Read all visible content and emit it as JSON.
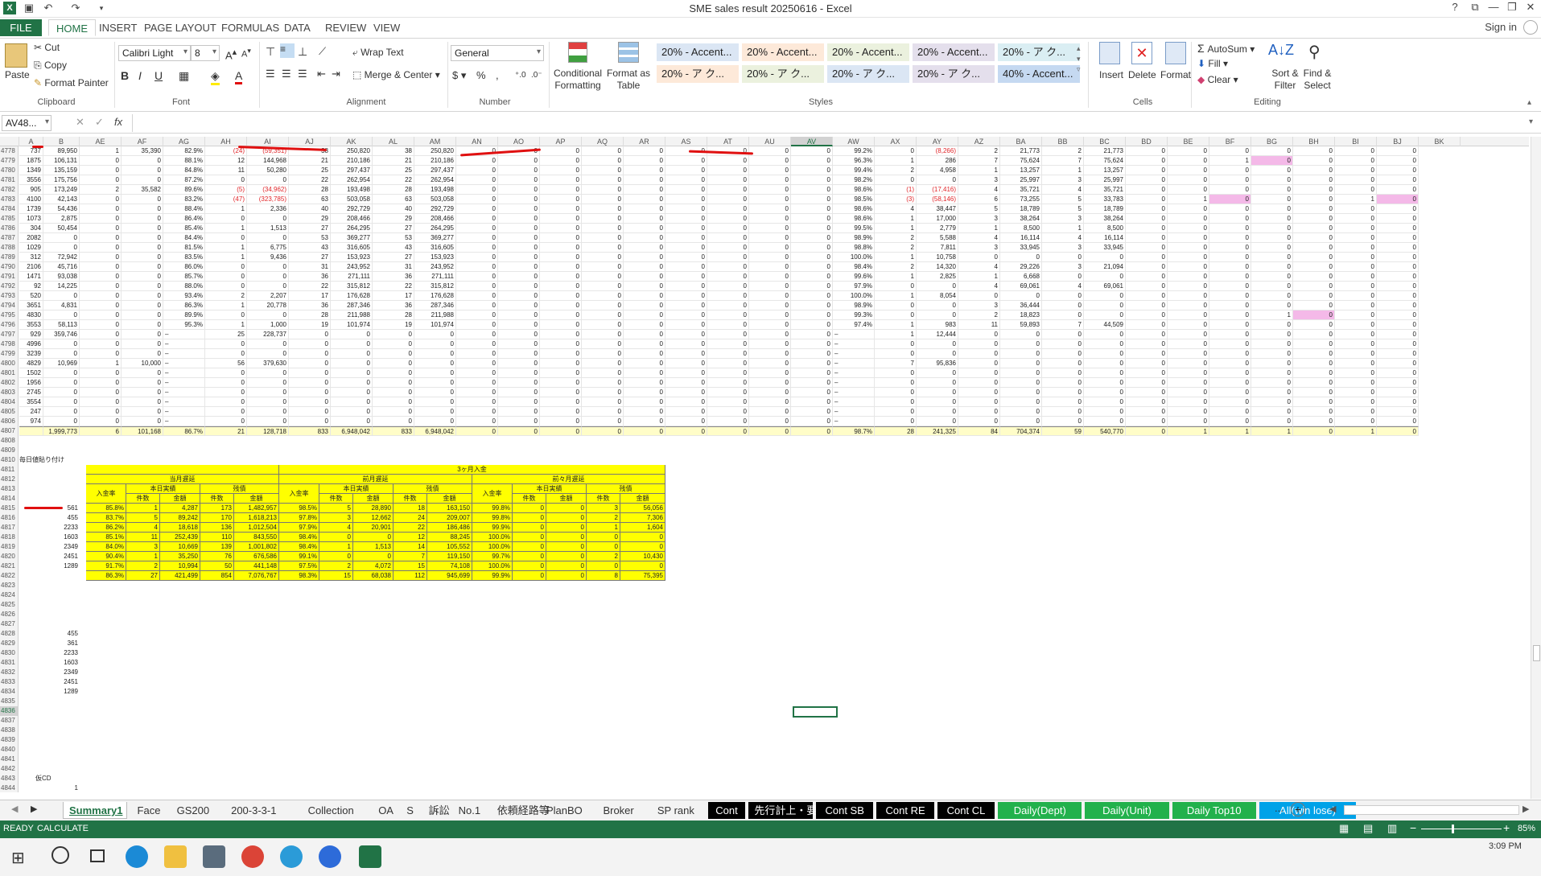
{
  "window": {
    "title": "SME sales result 20250616 - Excel",
    "signin": "Sign in",
    "help": "?"
  },
  "ribbon_tabs": [
    "FILE",
    "HOME",
    "INSERT",
    "PAGE LAYOUT",
    "FORMULAS",
    "DATA",
    "REVIEW",
    "VIEW"
  ],
  "clipboard": {
    "paste": "Paste",
    "cut": "Cut",
    "copy": "Copy",
    "format_painter": "Format Painter",
    "label": "Clipboard"
  },
  "font": {
    "name": "Calibri Light",
    "size": "8",
    "label": "Font"
  },
  "alignment": {
    "wrap": "Wrap Text",
    "merge": "Merge & Center",
    "label": "Alignment"
  },
  "number": {
    "format": "General",
    "label": "Number",
    "pct": "%",
    "comma": ","
  },
  "styles": {
    "conditional": "Conditional Formatting",
    "format_table": "Format as Table",
    "label": "Styles",
    "cells": [
      [
        "20% - Accent...",
        "20% - Accent...",
        "20% - Accent...",
        "20% - Accent...",
        "20% - ア ク..."
      ],
      [
        "20% - ア ク...",
        "20% - ア ク...",
        "20% - ア ク...",
        "20% - ア ク...",
        "40% - Accent..."
      ]
    ],
    "colors": [
      [
        "#dbe6f4",
        "#fde9d9",
        "#ebf1de",
        "#e4dfec",
        "#daeef3"
      ],
      [
        "#fde9d9",
        "#ebf1de",
        "#dbe6f4",
        "#e4dfec",
        "#c5d9f1"
      ]
    ]
  },
  "cells_grp": {
    "insert": "Insert",
    "delete": "Delete",
    "format": "Format",
    "label": "Cells"
  },
  "editing": {
    "autosum": "AutoSum",
    "fill": "Fill",
    "clear": "Clear",
    "sort": "Sort & Filter",
    "find": "Find & Select",
    "label": "Editing"
  },
  "formula_bar": {
    "name_box": "AV48...",
    "fx": "fx",
    "value": ""
  },
  "columns": [
    "A",
    "B",
    "AE",
    "AF",
    "AG",
    "AH",
    "AI",
    "AJ",
    "AK",
    "AL",
    "AM",
    "AN",
    "AO",
    "AP",
    "AQ",
    "AR",
    "AS",
    "AT",
    "AU",
    "AV",
    "AW",
    "AX",
    "AY",
    "AZ",
    "BA",
    "BB",
    "BC",
    "BD",
    "BE",
    "BF",
    "BG",
    "BH",
    "BI",
    "BJ",
    "BK"
  ],
  "rows": [
    [
      "4778",
      "737",
      "89,950",
      "1",
      "35,390",
      "82.9%",
      "(24)",
      "(59,351)",
      "38",
      "250,820",
      "38",
      "250,820",
      "0",
      "0",
      "0",
      "0",
      "0",
      "0",
      "0",
      "0",
      "0",
      "99.2%",
      "0",
      "(8,266)",
      "2",
      "21,773",
      "2",
      "21,773",
      "0",
      "0",
      "0",
      "0",
      "0",
      "0",
      "0"
    ],
    [
      "4779",
      "1875",
      "106,131",
      "0",
      "0",
      "88.1%",
      "12",
      "144,968",
      "21",
      "210,186",
      "21",
      "210,186",
      "0",
      "0",
      "0",
      "0",
      "0",
      "0",
      "0",
      "0",
      "0",
      "96.3%",
      "1",
      "286",
      "7",
      "75,624",
      "7",
      "75,624",
      "0",
      "0",
      "1",
      "0",
      "0",
      "0",
      "0"
    ],
    [
      "4780",
      "1349",
      "135,159",
      "0",
      "0",
      "84.8%",
      "11",
      "50,280",
      "25",
      "297,437",
      "25",
      "297,437",
      "0",
      "0",
      "0",
      "0",
      "0",
      "0",
      "0",
      "0",
      "0",
      "99.4%",
      "2",
      "4,958",
      "1",
      "13,257",
      "1",
      "13,257",
      "0",
      "0",
      "0",
      "0",
      "0",
      "0",
      "0"
    ],
    [
      "4781",
      "3556",
      "175,756",
      "0",
      "0",
      "87.2%",
      "0",
      "0",
      "22",
      "262,954",
      "22",
      "262,954",
      "0",
      "0",
      "0",
      "0",
      "0",
      "0",
      "0",
      "0",
      "0",
      "98.2%",
      "0",
      "0",
      "3",
      "25,997",
      "3",
      "25,997",
      "0",
      "0",
      "0",
      "0",
      "0",
      "0",
      "0"
    ],
    [
      "4782",
      "905",
      "173,249",
      "2",
      "35,582",
      "89.6%",
      "(5)",
      "(34,962)",
      "28",
      "193,498",
      "28",
      "193,498",
      "0",
      "0",
      "0",
      "0",
      "0",
      "0",
      "0",
      "0",
      "0",
      "98.6%",
      "(1)",
      "(17,416)",
      "4",
      "35,721",
      "4",
      "35,721",
      "0",
      "0",
      "0",
      "0",
      "0",
      "0",
      "0"
    ],
    [
      "4783",
      "4100",
      "42,143",
      "0",
      "0",
      "83.2%",
      "(47)",
      "(323,785)",
      "63",
      "503,058",
      "63",
      "503,058",
      "0",
      "0",
      "0",
      "0",
      "0",
      "0",
      "0",
      "0",
      "0",
      "98.5%",
      "(3)",
      "(58,146)",
      "6",
      "73,255",
      "5",
      "33,783",
      "0",
      "1",
      "0",
      "0",
      "0",
      "1",
      "0"
    ],
    [
      "4784",
      "1739",
      "54,436",
      "0",
      "0",
      "88.4%",
      "1",
      "2,336",
      "40",
      "292,729",
      "40",
      "292,729",
      "0",
      "0",
      "0",
      "0",
      "0",
      "0",
      "0",
      "0",
      "0",
      "98.6%",
      "4",
      "38,447",
      "5",
      "18,789",
      "5",
      "18,789",
      "0",
      "0",
      "0",
      "0",
      "0",
      "0",
      "0"
    ],
    [
      "4785",
      "1073",
      "2,875",
      "0",
      "0",
      "86.4%",
      "0",
      "0",
      "29",
      "208,466",
      "29",
      "208,466",
      "0",
      "0",
      "0",
      "0",
      "0",
      "0",
      "0",
      "0",
      "0",
      "98.6%",
      "1",
      "17,000",
      "3",
      "38,264",
      "3",
      "38,264",
      "0",
      "0",
      "0",
      "0",
      "0",
      "0",
      "0"
    ],
    [
      "4786",
      "304",
      "50,454",
      "0",
      "0",
      "85.4%",
      "1",
      "1,513",
      "27",
      "264,295",
      "27",
      "264,295",
      "0",
      "0",
      "0",
      "0",
      "0",
      "0",
      "0",
      "0",
      "0",
      "99.5%",
      "1",
      "2,779",
      "1",
      "8,500",
      "1",
      "8,500",
      "0",
      "0",
      "0",
      "0",
      "0",
      "0",
      "0"
    ],
    [
      "4787",
      "2082",
      "0",
      "0",
      "0",
      "84.4%",
      "0",
      "0",
      "53",
      "369,277",
      "53",
      "369,277",
      "0",
      "0",
      "0",
      "0",
      "0",
      "0",
      "0",
      "0",
      "0",
      "98.9%",
      "2",
      "5,588",
      "4",
      "16,114",
      "4",
      "16,114",
      "0",
      "0",
      "0",
      "0",
      "0",
      "0",
      "0"
    ],
    [
      "4788",
      "1029",
      "0",
      "0",
      "0",
      "81.5%",
      "1",
      "6,775",
      "43",
      "316,605",
      "43",
      "316,605",
      "0",
      "0",
      "0",
      "0",
      "0",
      "0",
      "0",
      "0",
      "0",
      "98.8%",
      "2",
      "7,811",
      "3",
      "33,945",
      "3",
      "33,945",
      "0",
      "0",
      "0",
      "0",
      "0",
      "0",
      "0"
    ],
    [
      "4789",
      "312",
      "72,942",
      "0",
      "0",
      "83.5%",
      "1",
      "9,436",
      "27",
      "153,923",
      "27",
      "153,923",
      "0",
      "0",
      "0",
      "0",
      "0",
      "0",
      "0",
      "0",
      "0",
      "100.0%",
      "1",
      "10,758",
      "0",
      "0",
      "0",
      "0",
      "0",
      "0",
      "0",
      "0",
      "0",
      "0",
      "0"
    ],
    [
      "4790",
      "2106",
      "45,716",
      "0",
      "0",
      "86.0%",
      "0",
      "0",
      "31",
      "243,952",
      "31",
      "243,952",
      "0",
      "0",
      "0",
      "0",
      "0",
      "0",
      "0",
      "0",
      "0",
      "98.4%",
      "2",
      "14,320",
      "4",
      "29,226",
      "3",
      "21,094",
      "0",
      "0",
      "0",
      "0",
      "0",
      "0",
      "0"
    ],
    [
      "4791",
      "1471",
      "93,038",
      "0",
      "0",
      "85.7%",
      "0",
      "0",
      "36",
      "271,111",
      "36",
      "271,111",
      "0",
      "0",
      "0",
      "0",
      "0",
      "0",
      "0",
      "0",
      "0",
      "99.6%",
      "1",
      "2,825",
      "1",
      "6,668",
      "0",
      "0",
      "0",
      "0",
      "0",
      "0",
      "0",
      "0",
      "0"
    ],
    [
      "4792",
      "92",
      "14,225",
      "0",
      "0",
      "88.0%",
      "0",
      "0",
      "22",
      "315,812",
      "22",
      "315,812",
      "0",
      "0",
      "0",
      "0",
      "0",
      "0",
      "0",
      "0",
      "0",
      "97.9%",
      "0",
      "0",
      "4",
      "69,061",
      "4",
      "69,061",
      "0",
      "0",
      "0",
      "0",
      "0",
      "0",
      "0"
    ],
    [
      "4793",
      "520",
      "0",
      "0",
      "0",
      "93.4%",
      "2",
      "2,207",
      "17",
      "176,628",
      "17",
      "176,628",
      "0",
      "0",
      "0",
      "0",
      "0",
      "0",
      "0",
      "0",
      "0",
      "100.0%",
      "1",
      "8,054",
      "0",
      "0",
      "0",
      "0",
      "0",
      "0",
      "0",
      "0",
      "0",
      "0",
      "0"
    ],
    [
      "4794",
      "3651",
      "4,831",
      "0",
      "0",
      "86.3%",
      "1",
      "20,778",
      "36",
      "287,346",
      "36",
      "287,346",
      "0",
      "0",
      "0",
      "0",
      "0",
      "0",
      "0",
      "0",
      "0",
      "98.9%",
      "0",
      "0",
      "3",
      "36,444",
      "0",
      "0",
      "0",
      "0",
      "0",
      "0",
      "0",
      "0",
      "0"
    ],
    [
      "4795",
      "4830",
      "0",
      "0",
      "0",
      "89.9%",
      "0",
      "0",
      "28",
      "211,988",
      "28",
      "211,988",
      "0",
      "0",
      "0",
      "0",
      "0",
      "0",
      "0",
      "0",
      "0",
      "99.3%",
      "0",
      "0",
      "2",
      "18,823",
      "0",
      "0",
      "0",
      "0",
      "0",
      "1",
      "0",
      "0",
      "0"
    ],
    [
      "4796",
      "3553",
      "58,113",
      "0",
      "0",
      "95.3%",
      "1",
      "1,000",
      "19",
      "101,974",
      "19",
      "101,974",
      "0",
      "0",
      "0",
      "0",
      "0",
      "0",
      "0",
      "0",
      "0",
      "97.4%",
      "1",
      "983",
      "11",
      "59,893",
      "7",
      "44,509",
      "0",
      "0",
      "0",
      "0",
      "0",
      "0",
      "0"
    ],
    [
      "4797",
      "929",
      "359,746",
      "0",
      "0",
      "–",
      "25",
      "228,737",
      "0",
      "0",
      "0",
      "0",
      "0",
      "0",
      "0",
      "0",
      "0",
      "0",
      "0",
      "0",
      "0",
      "–",
      "1",
      "12,444",
      "0",
      "0",
      "0",
      "0",
      "0",
      "0",
      "0",
      "0",
      "0",
      "0",
      "0"
    ],
    [
      "4798",
      "4996",
      "0",
      "0",
      "0",
      "–",
      "0",
      "0",
      "0",
      "0",
      "0",
      "0",
      "0",
      "0",
      "0",
      "0",
      "0",
      "0",
      "0",
      "0",
      "0",
      "–",
      "0",
      "0",
      "0",
      "0",
      "0",
      "0",
      "0",
      "0",
      "0",
      "0",
      "0",
      "0",
      "0"
    ],
    [
      "4799",
      "3239",
      "0",
      "0",
      "0",
      "–",
      "0",
      "0",
      "0",
      "0",
      "0",
      "0",
      "0",
      "0",
      "0",
      "0",
      "0",
      "0",
      "0",
      "0",
      "0",
      "–",
      "0",
      "0",
      "0",
      "0",
      "0",
      "0",
      "0",
      "0",
      "0",
      "0",
      "0",
      "0",
      "0"
    ],
    [
      "4800",
      "4829",
      "10,969",
      "1",
      "10,000",
      "–",
      "56",
      "379,630",
      "0",
      "0",
      "0",
      "0",
      "0",
      "0",
      "0",
      "0",
      "0",
      "0",
      "0",
      "0",
      "0",
      "–",
      "7",
      "95,836",
      "0",
      "0",
      "0",
      "0",
      "0",
      "0",
      "0",
      "0",
      "0",
      "0",
      "0"
    ],
    [
      "4801",
      "1502",
      "0",
      "0",
      "0",
      "–",
      "0",
      "0",
      "0",
      "0",
      "0",
      "0",
      "0",
      "0",
      "0",
      "0",
      "0",
      "0",
      "0",
      "0",
      "0",
      "–",
      "0",
      "0",
      "0",
      "0",
      "0",
      "0",
      "0",
      "0",
      "0",
      "0",
      "0",
      "0",
      "0"
    ],
    [
      "4802",
      "1956",
      "0",
      "0",
      "0",
      "–",
      "0",
      "0",
      "0",
      "0",
      "0",
      "0",
      "0",
      "0",
      "0",
      "0",
      "0",
      "0",
      "0",
      "0",
      "0",
      "–",
      "0",
      "0",
      "0",
      "0",
      "0",
      "0",
      "0",
      "0",
      "0",
      "0",
      "0",
      "0",
      "0"
    ],
    [
      "4803",
      "2745",
      "0",
      "0",
      "0",
      "–",
      "0",
      "0",
      "0",
      "0",
      "0",
      "0",
      "0",
      "0",
      "0",
      "0",
      "0",
      "0",
      "0",
      "0",
      "0",
      "–",
      "0",
      "0",
      "0",
      "0",
      "0",
      "0",
      "0",
      "0",
      "0",
      "0",
      "0",
      "0",
      "0"
    ],
    [
      "4804",
      "3554",
      "0",
      "0",
      "0",
      "–",
      "0",
      "0",
      "0",
      "0",
      "0",
      "0",
      "0",
      "0",
      "0",
      "0",
      "0",
      "0",
      "0",
      "0",
      "0",
      "–",
      "0",
      "0",
      "0",
      "0",
      "0",
      "0",
      "0",
      "0",
      "0",
      "0",
      "0",
      "0",
      "0"
    ],
    [
      "4805",
      "247",
      "0",
      "0",
      "0",
      "–",
      "0",
      "0",
      "0",
      "0",
      "0",
      "0",
      "0",
      "0",
      "0",
      "0",
      "0",
      "0",
      "0",
      "0",
      "0",
      "–",
      "0",
      "0",
      "0",
      "0",
      "0",
      "0",
      "0",
      "0",
      "0",
      "0",
      "0",
      "0",
      "0"
    ],
    [
      "4806",
      "974",
      "0",
      "0",
      "0",
      "–",
      "0",
      "0",
      "0",
      "0",
      "0",
      "0",
      "0",
      "0",
      "0",
      "0",
      "0",
      "0",
      "0",
      "0",
      "0",
      "–",
      "0",
      "0",
      "0",
      "0",
      "0",
      "0",
      "0",
      "0",
      "0",
      "0",
      "0",
      "0",
      "0"
    ]
  ],
  "total_row": [
    "4807",
    "",
    "1,999,773",
    "6",
    "101,168",
    "86.7%",
    "21",
    "128,718",
    "833",
    "6,948,042",
    "833",
    "6,948,042",
    "0",
    "0",
    "0",
    "0",
    "0",
    "0",
    "0",
    "0",
    "0",
    "98.7%",
    "28",
    "241,325",
    "84",
    "704,374",
    "59",
    "540,770",
    "0",
    "1",
    "1",
    "1",
    "0",
    "1",
    "0"
  ],
  "lower_label": "毎日値貼り付け",
  "lower_row_numbers": [
    "4808",
    "4809",
    "4810",
    "4811",
    "4812",
    "4813",
    "4814",
    "4815",
    "4816",
    "4817",
    "4818",
    "4819",
    "4820",
    "4821",
    "4822",
    "4823",
    "4824",
    "4825",
    "4826",
    "4827",
    "4828",
    "4829",
    "4830",
    "4831",
    "4832",
    "4833",
    "4834",
    "4835",
    "4836",
    "4837",
    "4838",
    "4839",
    "4840",
    "4841",
    "4842",
    "4843",
    "4844"
  ],
  "summary_table": {
    "top_header": "3ヶ月入金",
    "group_headers": [
      "当月遅延",
      "前月遅延",
      "前々月遅延"
    ],
    "sub_headers": [
      "入金率",
      "本日実績",
      "残債"
    ],
    "leaf_headers": [
      "件数",
      "金額",
      "件数",
      "金額"
    ],
    "b_col": [
      "561",
      "455",
      "2233",
      "1603",
      "2349",
      "2451",
      "1289",
      ""
    ],
    "rows": [
      [
        "85.8%",
        "1",
        "4,287",
        "173",
        "1,482,957",
        "98.5%",
        "5",
        "28,890",
        "18",
        "163,150",
        "99.8%",
        "0",
        "0",
        "3",
        "56,056"
      ],
      [
        "83.7%",
        "5",
        "89,242",
        "170",
        "1,618,213",
        "97.8%",
        "3",
        "12,662",
        "24",
        "209,007",
        "99.8%",
        "0",
        "0",
        "2",
        "7,306"
      ],
      [
        "86.2%",
        "4",
        "18,618",
        "136",
        "1,012,504",
        "97.9%",
        "4",
        "20,901",
        "22",
        "186,486",
        "99.9%",
        "0",
        "0",
        "1",
        "1,604"
      ],
      [
        "85.1%",
        "11",
        "252,439",
        "110",
        "843,550",
        "98.4%",
        "0",
        "0",
        "12",
        "88,245",
        "100.0%",
        "0",
        "0",
        "0",
        "0"
      ],
      [
        "84.0%",
        "3",
        "10,669",
        "139",
        "1,001,802",
        "98.4%",
        "1",
        "1,513",
        "14",
        "105,552",
        "100.0%",
        "0",
        "0",
        "0",
        "0"
      ],
      [
        "90.4%",
        "1",
        "35,250",
        "76",
        "676,586",
        "99.1%",
        "0",
        "0",
        "7",
        "119,150",
        "99.7%",
        "0",
        "0",
        "2",
        "10,430"
      ],
      [
        "91.7%",
        "2",
        "10,994",
        "50",
        "441,148",
        "97.5%",
        "2",
        "4,072",
        "15",
        "74,108",
        "100.0%",
        "0",
        "0",
        "0",
        "0"
      ],
      [
        "86.3%",
        "27",
        "421,499",
        "854",
        "7,076,767",
        "98.3%",
        "15",
        "68,038",
        "112",
        "945,699",
        "99.9%",
        "0",
        "0",
        "8",
        "75,395"
      ]
    ]
  },
  "lower_list": [
    "455",
    "361",
    "2233",
    "1603",
    "2349",
    "2451",
    "1289"
  ],
  "bottom_cells": {
    "label_4843": "仮CD",
    "value_4844": "1"
  },
  "sheet_tabs": [
    {
      "label": "Summary1",
      "style": "active"
    },
    {
      "label": "Face",
      "style": ""
    },
    {
      "label": "GS200",
      "style": ""
    },
    {
      "label": "200-3-3-1",
      "style": ""
    },
    {
      "label": "Collection",
      "style": ""
    },
    {
      "label": "OA",
      "style": ""
    },
    {
      "label": "S",
      "style": ""
    },
    {
      "label": "訴訟",
      "style": ""
    },
    {
      "label": "No.1",
      "style": ""
    },
    {
      "label": "依頼経路等",
      "style": ""
    },
    {
      "label": "PlanBO",
      "style": ""
    },
    {
      "label": "Broker",
      "style": ""
    },
    {
      "label": "SP rank",
      "style": ""
    },
    {
      "label": "Cont",
      "style": "black"
    },
    {
      "label": "先行計上・要削除",
      "style": "black"
    },
    {
      "label": "Cont SB",
      "style": "black"
    },
    {
      "label": "Cont RE",
      "style": "black"
    },
    {
      "label": "Cont CL",
      "style": "black"
    },
    {
      "label": "Daily(Dept)",
      "style": "green"
    },
    {
      "label": "Daily(Unit)",
      "style": "green"
    },
    {
      "label": "Daily Top10",
      "style": "green"
    },
    {
      "label": "All(win lose)",
      "style": "blue"
    }
  ],
  "status": {
    "ready": "READY",
    "calculate": "CALCULATE",
    "zoom": "85%"
  },
  "taskbar": {
    "time": "3:09 PM"
  }
}
